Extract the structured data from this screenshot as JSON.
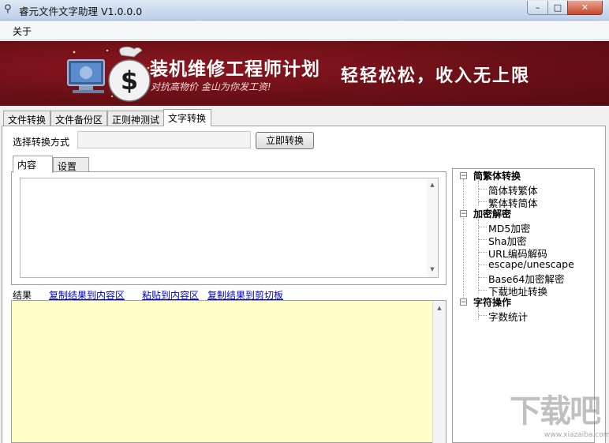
{
  "window": {
    "title": "睿元文件文字助理 V1.0.0.0",
    "buttons": {
      "minimize": "–",
      "maximize": "□",
      "close": "✕"
    }
  },
  "menu": {
    "about": "关于"
  },
  "banner": {
    "title": "装机维修工程师计划",
    "subtitle": "对抗高物价 金山为你发工资!",
    "slogan": "轻轻松松，收入无上限",
    "icon": "money-bag-computer-icon"
  },
  "tabs": [
    "文件转换",
    "文件备份区",
    "正则神测试",
    "文字转换"
  ],
  "active_tab": "文字转换",
  "toolbar": {
    "method_label": "选择转换方式",
    "method_value": "",
    "convert_button": "立即转换"
  },
  "subtabs": [
    "内容",
    "设置"
  ],
  "active_subtab": "内容",
  "results": {
    "label": "结果",
    "links": [
      "复制结果到内容区",
      "粘贴到内容区",
      "复制结果到剪切板"
    ]
  },
  "tree": {
    "groups": [
      {
        "label": "简繁体转换",
        "items": [
          "简体转繁体",
          "繁体转简体"
        ]
      },
      {
        "label": "加密解密",
        "items": [
          "MD5加密",
          "Sha加密",
          "URL编码解码",
          "escape/unescape",
          "Base64加密解密",
          "下载地址转换"
        ]
      },
      {
        "label": "字符操作",
        "items": [
          "字数统计"
        ]
      }
    ]
  },
  "watermark": {
    "logo": "下载吧",
    "url": "www.xiazaiba.com"
  },
  "colors": {
    "banner_bg": "#6a0f16",
    "result_bg": "#ffffc8",
    "link": "#0000cc"
  }
}
